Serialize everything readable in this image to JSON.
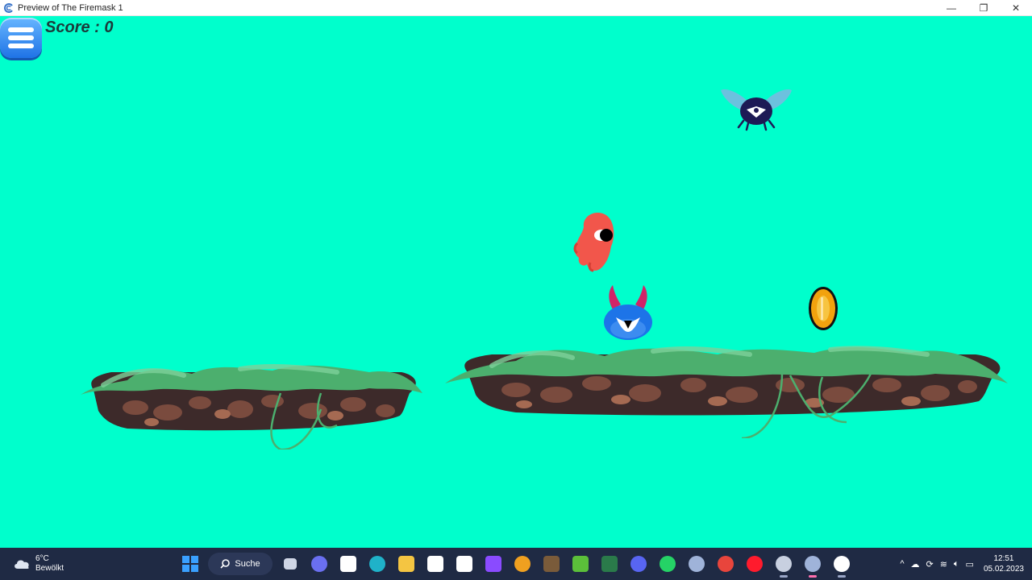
{
  "window": {
    "title": "Preview of The Firemask 1",
    "minimize": "—",
    "restore": "❐",
    "close": "✕"
  },
  "game": {
    "score_text": "Score : 0",
    "menu_icon": "hamburger-menu-icon",
    "background_color": "#00ffcc"
  },
  "taskbar": {
    "weather_temp": "6°C",
    "weather_desc": "Bewölkt",
    "search_label": "Suche",
    "clock_time": "12:51",
    "clock_date": "05.02.2023",
    "apps": [
      {
        "name": "start-icon",
        "color": "#3aa0ff"
      },
      {
        "name": "task-view-icon",
        "color": "#cfd6e6"
      },
      {
        "name": "teams-chat-icon",
        "color": "#6a6ff0"
      },
      {
        "name": "store-icon",
        "color": "#ffffff"
      },
      {
        "name": "edge-icon",
        "color": "#1fb2c9"
      },
      {
        "name": "file-explorer-icon",
        "color": "#f4c542"
      },
      {
        "name": "amazon-icon",
        "color": "#ffffff"
      },
      {
        "name": "capcut-icon",
        "color": "#ffffff"
      },
      {
        "name": "clipchamp-icon",
        "color": "#8a4bff"
      },
      {
        "name": "vpn-icon",
        "color": "#f0a020"
      },
      {
        "name": "minecraft-icon",
        "color": "#7a5b3a"
      },
      {
        "name": "minecraft-launcher-icon",
        "color": "#5bbf3a"
      },
      {
        "name": "minecraft-education-icon",
        "color": "#2a7a4a"
      },
      {
        "name": "discord-icon",
        "color": "#5865f2"
      },
      {
        "name": "whatsapp-icon",
        "color": "#25d366"
      },
      {
        "name": "construct-icon",
        "color": "#9fb3d9"
      },
      {
        "name": "chrome-icon",
        "color": "#e8453c"
      },
      {
        "name": "opera-icon",
        "color": "#ff1b2d"
      },
      {
        "name": "settings-icon",
        "color": "#c8d0e0"
      },
      {
        "name": "construct-preview-icon",
        "color": "#9fb3d9"
      },
      {
        "name": "obs-icon",
        "color": "#ffffff"
      }
    ]
  }
}
